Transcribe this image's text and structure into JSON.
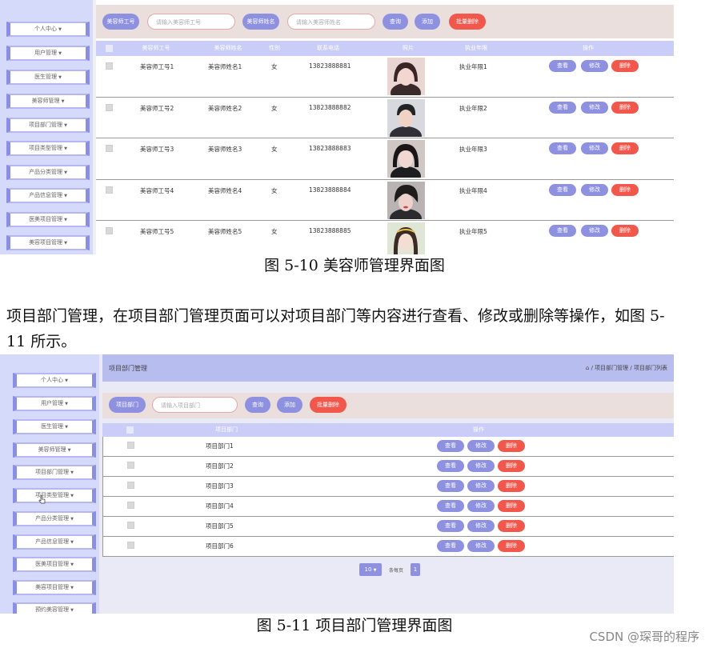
{
  "figure1": {
    "sidebar": [
      "个人中心",
      "用户管理",
      "医生管理",
      "美容师管理",
      "项目部门管理",
      "项目类型管理",
      "产品分类管理",
      "产品信息管理",
      "医美项目管理",
      "美容项目管理"
    ],
    "search": {
      "label1": "美容师工号",
      "input1_placeholder": "请输入美容师工号",
      "label2": "美容师姓名",
      "input2_placeholder": "请输入美容师姓名",
      "query": "查询",
      "add": "添加",
      "batch_delete": "批量删除"
    },
    "columns": [
      "美容师工号",
      "美容师姓名",
      "性别",
      "联系电话",
      "照片",
      "执业年限",
      "操作"
    ],
    "rows": [
      {
        "id": "美容师工号1",
        "name": "美容师姓名1",
        "gender": "女",
        "phone": "13823888881",
        "years": "执业年限1"
      },
      {
        "id": "美容师工号2",
        "name": "美容师姓名2",
        "gender": "女",
        "phone": "13823888882",
        "years": "执业年限2"
      },
      {
        "id": "美容师工号3",
        "name": "美容师姓名3",
        "gender": "女",
        "phone": "13823888883",
        "years": "执业年限3"
      },
      {
        "id": "美容师工号4",
        "name": "美容师姓名4",
        "gender": "女",
        "phone": "13823888884",
        "years": "执业年限4"
      },
      {
        "id": "美容师工号5",
        "name": "美容师姓名5",
        "gender": "女",
        "phone": "13823888885",
        "years": "执业年限5"
      }
    ],
    "actions": {
      "view": "查看",
      "edit": "修改",
      "delete": "删除"
    },
    "caption": "图 5-10 美容师管理界面图"
  },
  "paragraph": "项目部门管理，在项目部门管理页面可以对项目部门等内容进行查看、修改或删除等操作，如图 5-11 所示。",
  "figure2": {
    "title": "项目部门管理",
    "breadcrumb": "/ 项目部门管理 / 项目部门列表",
    "sidebar": [
      "个人中心",
      "用户管理",
      "医生管理",
      "美容师管理",
      "项目部门管理",
      "项目类型管理",
      "产品分类管理",
      "产品信息管理",
      "医美项目管理",
      "美容项目管理",
      "预约美容管理"
    ],
    "search": {
      "label": "项目部门",
      "input_placeholder": "请输入项目部门",
      "query": "查询",
      "add": "添加",
      "batch_delete": "批量删除"
    },
    "columns": [
      "项目部门",
      "操作"
    ],
    "rows": [
      "项目部门1",
      "项目部门2",
      "项目部门3",
      "项目部门4",
      "项目部门5",
      "项目部门6"
    ],
    "actions": {
      "view": "查看",
      "edit": "修改",
      "delete": "删除"
    },
    "pagination": {
      "page_size": "10",
      "per_page_label": "条每页",
      "current_page": "1"
    },
    "caption": "图 5-11 项目部门管理界面图"
  },
  "watermark": "CSDN @琛哥的程序"
}
